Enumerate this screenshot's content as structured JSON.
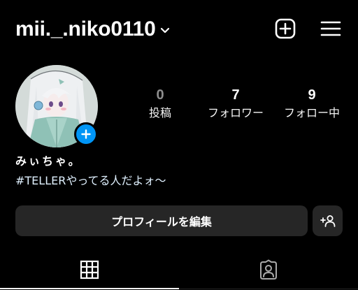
{
  "header": {
    "username": "mii._.niko0110",
    "dropdown_icon": "chevron-down-icon",
    "create_icon": "add-square-icon",
    "menu_icon": "hamburger-menu-icon"
  },
  "profile": {
    "avatar_icon": "profile-avatar",
    "add_story_icon": "plus-icon",
    "display_name": "みぃちゃ。",
    "bio": "#TELLERやってる人だよォ〜"
  },
  "stats": {
    "posts": {
      "count": "0",
      "label": "投稿"
    },
    "followers": {
      "count": "7",
      "label": "フォロワー"
    },
    "following": {
      "count": "9",
      "label": "フォロー中"
    }
  },
  "actions": {
    "edit_profile_label": "プロフィールを編集",
    "discover_people_icon": "add-person-icon"
  },
  "tabs": [
    {
      "name": "posts-grid",
      "icon": "grid-icon",
      "active": true
    },
    {
      "name": "tagged",
      "icon": "tagged-person-icon",
      "active": false
    }
  ],
  "colors": {
    "background": "#000000",
    "button_bg": "#262626",
    "accent_blue": "#0095f6",
    "muted_text": "#8e8e8e"
  }
}
